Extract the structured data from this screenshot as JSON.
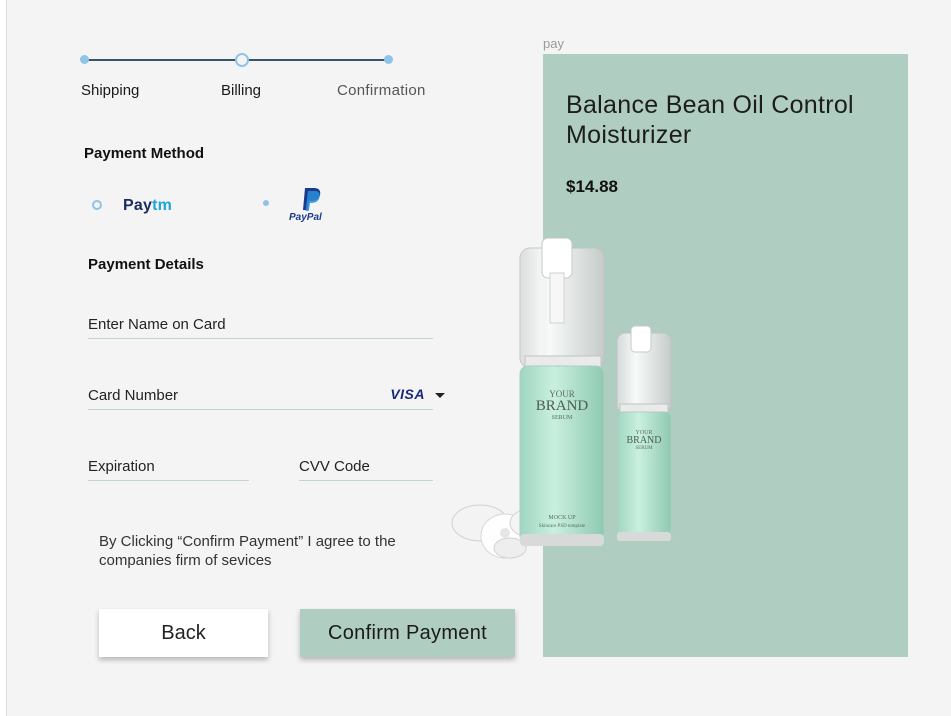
{
  "stepper": {
    "steps": [
      {
        "label": "Shipping",
        "state": "done"
      },
      {
        "label": "Billing",
        "state": "current"
      },
      {
        "label": "Confirmation",
        "state": "upcoming"
      }
    ]
  },
  "payment_method": {
    "title": "Payment Method",
    "options": [
      {
        "name": "paytm",
        "label_pay": "Pay",
        "label_tm": "tm",
        "selected": false
      },
      {
        "name": "paypal",
        "label": "PayPal",
        "selected": true
      }
    ]
  },
  "payment_details": {
    "title": "Payment Details",
    "name_on_card": "Enter Name on Card",
    "card_number": "Card Number",
    "card_brand": "VISA",
    "expiration": "Expiration",
    "cvv": "CVV Code"
  },
  "terms": "By Clicking “Confirm Payment” I agree to the companies firm of sevices",
  "buttons": {
    "back": "Back",
    "confirm": "Confirm Payment"
  },
  "product": {
    "frame_label": "pay",
    "name": "Balance Bean Oil Control Moisturizer",
    "price": "$14.88",
    "bottle_brand_top": "YOUR",
    "bottle_brand": "BRAND",
    "bottle_brand_sub": "SERUM",
    "bottle_caption": "MOCK UP",
    "bottle_caption_sub": "Skincare PSD template"
  },
  "colors": {
    "accent": "#8fc3e8",
    "panel": "#b0cdc2",
    "step_line": "#33566b",
    "field_underline": "#c2d6cf"
  }
}
